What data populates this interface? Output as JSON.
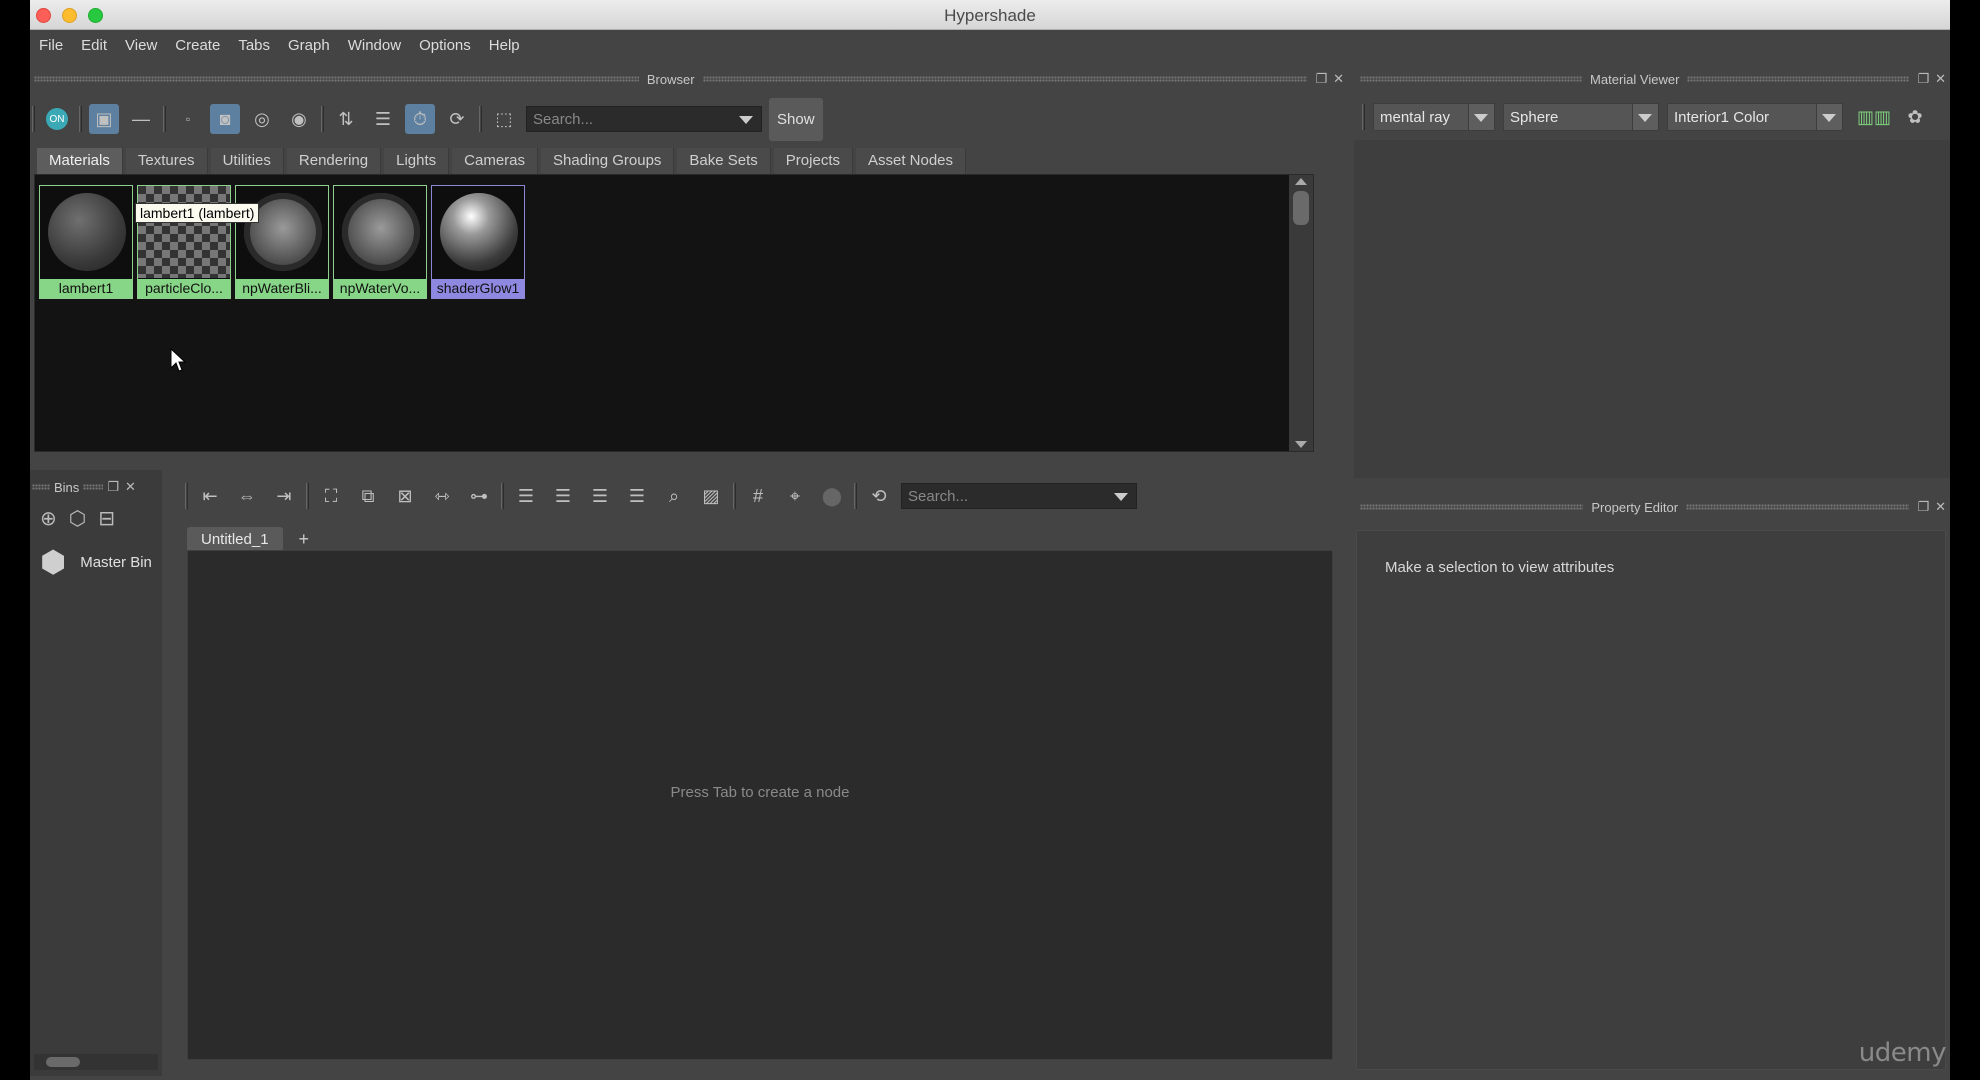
{
  "window": {
    "title": "Hypershade"
  },
  "menu": [
    "File",
    "Edit",
    "View",
    "Create",
    "Tabs",
    "Graph",
    "Window",
    "Options",
    "Help"
  ],
  "browser": {
    "title": "Browser",
    "search_placeholder": "Search...",
    "show_button": "Show",
    "tabs": [
      "Materials",
      "Textures",
      "Utilities",
      "Rendering",
      "Lights",
      "Cameras",
      "Shading Groups",
      "Bake Sets",
      "Projects",
      "Asset Nodes"
    ],
    "active_tab": "Materials",
    "swatches": [
      {
        "name": "lambert1",
        "color": "#87d687"
      },
      {
        "name": "particleClo...",
        "color": "#87d687"
      },
      {
        "name": "npWaterBli...",
        "color": "#87d687"
      },
      {
        "name": "npWaterVo...",
        "color": "#87d687"
      },
      {
        "name": "shaderGlow1",
        "color": "#8f88e0"
      }
    ],
    "tooltip": "lambert1 (lambert)"
  },
  "bins": {
    "title": "Bins",
    "master_bin": "Master Bin"
  },
  "node_editor": {
    "search_placeholder": "Search...",
    "tab": "Untitled_1",
    "add_tab": "+",
    "hint": "Press Tab to create a node"
  },
  "material_viewer": {
    "title": "Material Viewer",
    "renderer": "mental ray",
    "shape": "Sphere",
    "environment": "Interior1 Color"
  },
  "property_editor": {
    "title": "Property Editor",
    "message": "Make a selection to view attributes"
  },
  "watermark": "udemy",
  "toolbar_on_label": "ON"
}
